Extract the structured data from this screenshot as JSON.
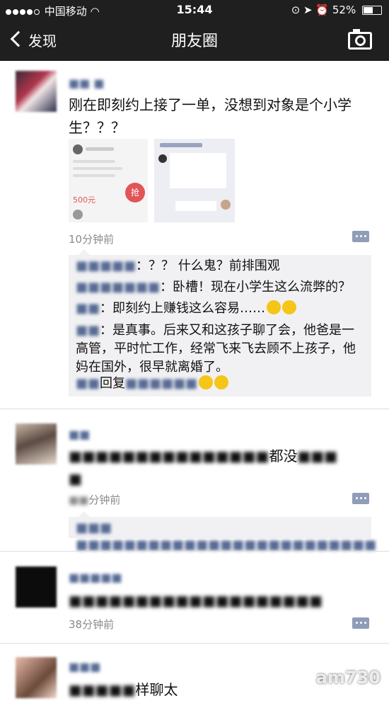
{
  "status_bar": {
    "carrier": "中国移动",
    "time": "15:44",
    "battery": "52%"
  },
  "nav": {
    "back_label": "发现",
    "title": "朋友圈"
  },
  "posts": [
    {
      "text": "刚在即刻约上接了一单，没想到对象是个小学生？？？",
      "time": "10分钟前",
      "images": {
        "left_price": "500元",
        "left_button": "抢"
      },
      "comments": [
        {
          "text": "：？？ 什么鬼？前排围观"
        },
        {
          "text": "：卧槽！现在小学生这么流弊的？"
        },
        {
          "text": "：即刻约上赚钱这么容易……"
        },
        {
          "text": "：是真事。后来又和这孩子聊了会，他爸是一高管，平时忙工作，经常飞来飞去顾不上孩子，他妈在国外，很早就离婚了。"
        },
        {
          "text": "回复"
        }
      ]
    },
    {
      "text_visible": "都没",
      "time": "分钟前",
      "comments": [
        {
          "text": ""
        }
      ]
    },
    {
      "time": "38分钟前"
    },
    {
      "text_visible": "样聊太"
    }
  ],
  "watermark": "am730"
}
